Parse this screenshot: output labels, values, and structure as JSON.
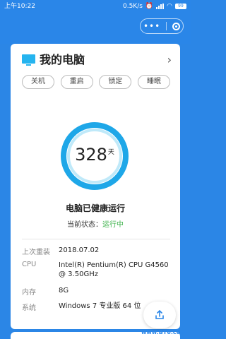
{
  "status_bar": {
    "time": "上午10:22",
    "net_speed": "0.5K/s",
    "battery": "99"
  },
  "header": {
    "title": "我的电脑",
    "monitor_icon": "monitor-icon",
    "chevron_icon": "chevron-right-icon"
  },
  "actions": [
    {
      "label": "关机"
    },
    {
      "label": "重启"
    },
    {
      "label": "锁定"
    },
    {
      "label": "睡眠"
    }
  ],
  "uptime": {
    "days": "328",
    "unit": "天"
  },
  "health_text": "电脑已健康运行",
  "state": {
    "label": "当前状态：",
    "value": "运行中"
  },
  "info": [
    {
      "label": "上次重装",
      "value": "2018.07.02"
    },
    {
      "label": "CPU",
      "value": "Intel(R) Pentium(R) CPU G4560 @ 3.50GHz"
    },
    {
      "label": "内存",
      "value": "8G"
    },
    {
      "label": "系统",
      "value": "Windows 7 专业版 64 位"
    }
  ],
  "watermark": "www.BT6.com",
  "colors": {
    "primary": "#2a86e8",
    "ring_outer": "#1ea7e8",
    "accent_green": "#3cb24a",
    "icon_blue": "#25b4ef"
  }
}
